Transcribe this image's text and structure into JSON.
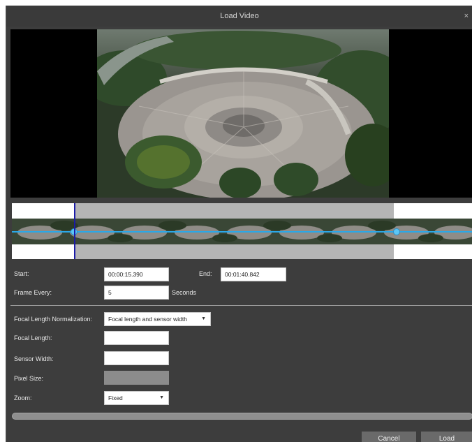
{
  "dialog": {
    "title": "Load Video",
    "close_glyph": "×"
  },
  "form": {
    "start_label": "Start:",
    "start_value": "00:00:15.390",
    "end_label": "End:",
    "end_value": "00:01:40.842",
    "frame_every_label": "Frame Every:",
    "frame_every_value": "5",
    "frame_every_unit": "Seconds",
    "focal_norm_label": "Focal Length Normalization:",
    "focal_norm_value": "Focal length and sensor width",
    "focal_length_label": "Focal Length:",
    "focal_length_value": "",
    "sensor_width_label": "Sensor Width:",
    "sensor_width_value": "",
    "pixel_size_label": "Pixel Size:",
    "pixel_size_value": "",
    "zoom_label": "Zoom:",
    "zoom_value": "Fixed"
  },
  "buttons": {
    "cancel": "Cancel",
    "load": "Load"
  },
  "icons": {
    "dropdown_caret": "chevron-down-icon",
    "close": "close-icon"
  },
  "colors": {
    "dialog_bg": "#3d3d3d",
    "track_line": "#2aa8e8",
    "playhead": "#1a1aa8",
    "selection": "#a8a8a8"
  }
}
